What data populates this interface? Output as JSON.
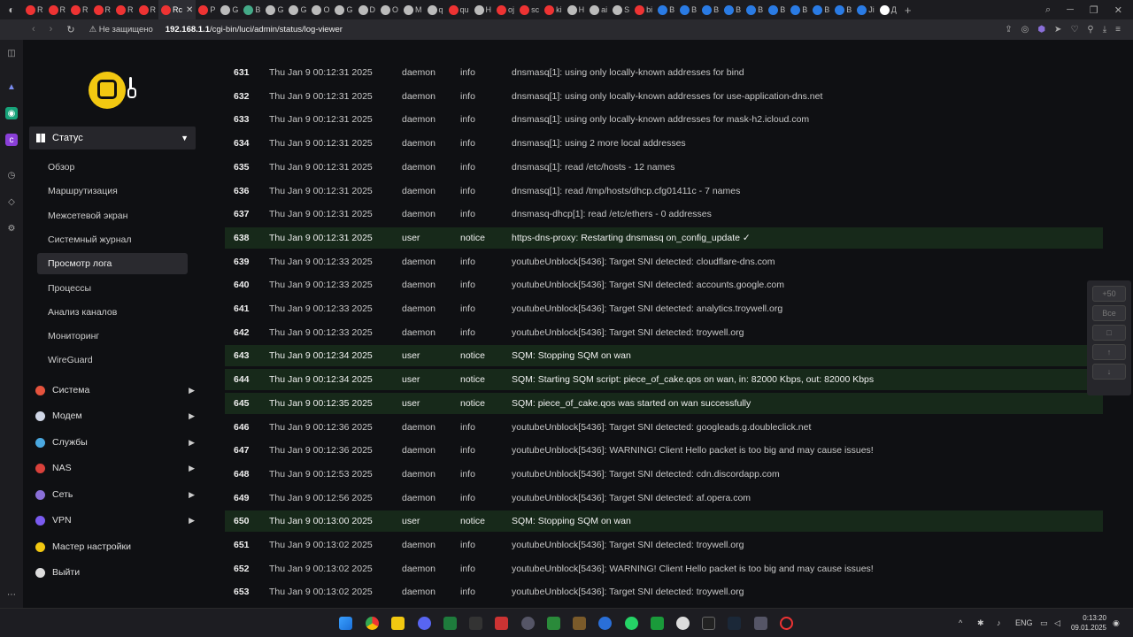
{
  "browser": {
    "tabs": [
      {
        "label": "R",
        "color": "#e33"
      },
      {
        "label": "R",
        "color": "#e33"
      },
      {
        "label": "R",
        "color": "#e33"
      },
      {
        "label": "R",
        "color": "#e33"
      },
      {
        "label": "R",
        "color": "#e33"
      },
      {
        "label": "R",
        "color": "#e33"
      },
      {
        "label": "Rc",
        "color": "#e33",
        "active": true
      },
      {
        "label": "P",
        "color": "#e33"
      },
      {
        "label": "G",
        "color": "#bbb"
      },
      {
        "label": "B",
        "color": "#4a8"
      },
      {
        "label": "G",
        "color": "#bbb"
      },
      {
        "label": "G",
        "color": "#bbb"
      },
      {
        "label": "O",
        "color": "#bbb"
      },
      {
        "label": "G",
        "color": "#bbb"
      },
      {
        "label": "D",
        "color": "#bbb"
      },
      {
        "label": "O",
        "color": "#bbb"
      },
      {
        "label": "M",
        "color": "#bbb"
      },
      {
        "label": "q",
        "color": "#bbb"
      },
      {
        "label": "qu",
        "color": "#e33"
      },
      {
        "label": "H",
        "color": "#bbb"
      },
      {
        "label": "oj",
        "color": "#e33"
      },
      {
        "label": "sc",
        "color": "#e33"
      },
      {
        "label": "ki",
        "color": "#e33"
      },
      {
        "label": "H",
        "color": "#bbb"
      },
      {
        "label": "ai",
        "color": "#bbb"
      },
      {
        "label": "S",
        "color": "#bbb"
      },
      {
        "label": "bi",
        "color": "#e33"
      },
      {
        "label": "B",
        "color": "#2a7be4"
      },
      {
        "label": "B",
        "color": "#2a7be4"
      },
      {
        "label": "B",
        "color": "#2a7be4"
      },
      {
        "label": "B",
        "color": "#2a7be4"
      },
      {
        "label": "B",
        "color": "#2a7be4"
      },
      {
        "label": "B",
        "color": "#2a7be4"
      },
      {
        "label": "B",
        "color": "#2a7be4"
      },
      {
        "label": "B",
        "color": "#2a7be4"
      },
      {
        "label": "B",
        "color": "#2a7be4"
      },
      {
        "label": "Ji",
        "color": "#2a7be4"
      },
      {
        "label": "Д",
        "color": "#fff"
      }
    ],
    "insecure_label": "Не защищено",
    "url_host": "192.168.1.1",
    "url_path": "/cgi-bin/luci/admin/status/log-viewer",
    "tab_close": "✕",
    "new_tab": "+",
    "window_controls": {
      "search": "⌕",
      "minimize": "─",
      "restore": "❐",
      "close": "✕"
    }
  },
  "sidebar": {
    "status_label": "Статус",
    "sub_items": [
      {
        "label": "Обзор"
      },
      {
        "label": "Маршрутизация"
      },
      {
        "label": "Межсетевой экран"
      },
      {
        "label": "Системный журнал"
      },
      {
        "label": "Просмотр лога",
        "active": true
      },
      {
        "label": "Процессы"
      },
      {
        "label": "Анализ каналов"
      },
      {
        "label": "Мониторинг"
      },
      {
        "label": "WireGuard"
      }
    ],
    "categories": [
      {
        "label": "Система",
        "color": "#e5533d",
        "chevron": true
      },
      {
        "label": "Модем",
        "color": "#cfd6e6",
        "chevron": true
      },
      {
        "label": "Службы",
        "color": "#4aa8e0",
        "chevron": true
      },
      {
        "label": "NAS",
        "color": "#d9413b",
        "chevron": true
      },
      {
        "label": "Сеть",
        "color": "#8a6fd8",
        "chevron": true
      },
      {
        "label": "VPN",
        "color": "#7a5bf0",
        "chevron": true
      },
      {
        "label": "Мастер настройки",
        "color": "#f2c811",
        "chevron": false
      },
      {
        "label": "Выйти",
        "color": "#dddddd",
        "chevron": false
      }
    ]
  },
  "log": [
    {
      "num": "631",
      "date": "Thu Jan 9 00:12:31 2025",
      "facility": "daemon",
      "level": "info",
      "message": "dnsmasq[1]: using only locally-known addresses for bind"
    },
    {
      "num": "632",
      "date": "Thu Jan 9 00:12:31 2025",
      "facility": "daemon",
      "level": "info",
      "message": "dnsmasq[1]: using only locally-known addresses for use-application-dns.net"
    },
    {
      "num": "633",
      "date": "Thu Jan 9 00:12:31 2025",
      "facility": "daemon",
      "level": "info",
      "message": "dnsmasq[1]: using only locally-known addresses for mask-h2.icloud.com"
    },
    {
      "num": "634",
      "date": "Thu Jan 9 00:12:31 2025",
      "facility": "daemon",
      "level": "info",
      "message": "dnsmasq[1]: using 2 more local addresses"
    },
    {
      "num": "635",
      "date": "Thu Jan 9 00:12:31 2025",
      "facility": "daemon",
      "level": "info",
      "message": "dnsmasq[1]: read /etc/hosts - 12 names"
    },
    {
      "num": "636",
      "date": "Thu Jan 9 00:12:31 2025",
      "facility": "daemon",
      "level": "info",
      "message": "dnsmasq[1]: read /tmp/hosts/dhcp.cfg01411c - 7 names"
    },
    {
      "num": "637",
      "date": "Thu Jan 9 00:12:31 2025",
      "facility": "daemon",
      "level": "info",
      "message": "dnsmasq-dhcp[1]: read /etc/ethers - 0 addresses"
    },
    {
      "num": "638",
      "date": "Thu Jan 9 00:12:31 2025",
      "facility": "user",
      "level": "notice",
      "message": "https-dns-proxy: Restarting dnsmasq on_config_update ✓"
    },
    {
      "num": "639",
      "date": "Thu Jan 9 00:12:33 2025",
      "facility": "daemon",
      "level": "info",
      "message": "youtubeUnblock[5436]: Target SNI detected: cloudflare-dns.com"
    },
    {
      "num": "640",
      "date": "Thu Jan 9 00:12:33 2025",
      "facility": "daemon",
      "level": "info",
      "message": "youtubeUnblock[5436]: Target SNI detected: accounts.google.com"
    },
    {
      "num": "641",
      "date": "Thu Jan 9 00:12:33 2025",
      "facility": "daemon",
      "level": "info",
      "message": "youtubeUnblock[5436]: Target SNI detected: analytics.troywell.org"
    },
    {
      "num": "642",
      "date": "Thu Jan 9 00:12:33 2025",
      "facility": "daemon",
      "level": "info",
      "message": "youtubeUnblock[5436]: Target SNI detected: troywell.org"
    },
    {
      "num": "643",
      "date": "Thu Jan 9 00:12:34 2025",
      "facility": "user",
      "level": "notice",
      "message": "SQM: Stopping SQM on wan"
    },
    {
      "num": "644",
      "date": "Thu Jan 9 00:12:34 2025",
      "facility": "user",
      "level": "notice",
      "message": "SQM: Starting SQM script: piece_of_cake.qos on wan, in: 82000 Kbps, out: 82000 Kbps"
    },
    {
      "num": "645",
      "date": "Thu Jan 9 00:12:35 2025",
      "facility": "user",
      "level": "notice",
      "message": "SQM: piece_of_cake.qos was started on wan successfully"
    },
    {
      "num": "646",
      "date": "Thu Jan 9 00:12:36 2025",
      "facility": "daemon",
      "level": "info",
      "message": "youtubeUnblock[5436]: Target SNI detected: googleads.g.doubleclick.net"
    },
    {
      "num": "647",
      "date": "Thu Jan 9 00:12:36 2025",
      "facility": "daemon",
      "level": "info",
      "message": "youtubeUnblock[5436]: WARNING! Client Hello packet is too big and may cause issues!"
    },
    {
      "num": "648",
      "date": "Thu Jan 9 00:12:53 2025",
      "facility": "daemon",
      "level": "info",
      "message": "youtubeUnblock[5436]: Target SNI detected: cdn.discordapp.com"
    },
    {
      "num": "649",
      "date": "Thu Jan 9 00:12:56 2025",
      "facility": "daemon",
      "level": "info",
      "message": "youtubeUnblock[5436]: Target SNI detected: af.opera.com"
    },
    {
      "num": "650",
      "date": "Thu Jan 9 00:13:00 2025",
      "facility": "user",
      "level": "notice",
      "message": "SQM: Stopping SQM on wan"
    },
    {
      "num": "651",
      "date": "Thu Jan 9 00:13:02 2025",
      "facility": "daemon",
      "level": "info",
      "message": "youtubeUnblock[5436]: Target SNI detected: troywell.org"
    },
    {
      "num": "652",
      "date": "Thu Jan 9 00:13:02 2025",
      "facility": "daemon",
      "level": "info",
      "message": "youtubeUnblock[5436]: WARNING! Client Hello packet is too big and may cause issues!"
    },
    {
      "num": "653",
      "date": "Thu Jan 9 00:13:02 2025",
      "facility": "daemon",
      "level": "info",
      "message": "youtubeUnblock[5436]: Target SNI detected: troywell.org"
    }
  ],
  "scroll_controls": {
    "plus50": "+50",
    "all": "Все",
    "stop": "□",
    "up": "↑",
    "down": "↓"
  },
  "taskbar": {
    "lang": "ENG",
    "time": "0:13:20",
    "date": "09.01.2025",
    "tray_chevron": "^"
  }
}
